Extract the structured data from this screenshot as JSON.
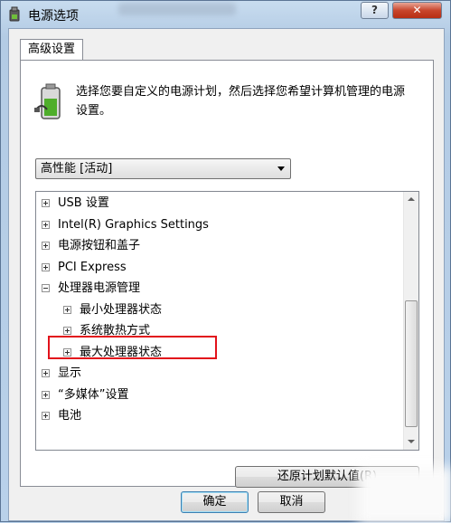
{
  "window": {
    "title": "电源选项",
    "help_label": "?",
    "close_label": "✕"
  },
  "tab": {
    "label": "高级设置"
  },
  "description": "选择您要自定义的电源计划，然后选择您希望计算机管理的电源设置。",
  "plan_select": {
    "value": "高性能 [活动]"
  },
  "tree": {
    "items": [
      {
        "label": "USB 设置",
        "level": 0,
        "expander": "plus"
      },
      {
        "label": "Intel(R) Graphics Settings",
        "level": 0,
        "expander": "plus"
      },
      {
        "label": "电源按钮和盖子",
        "level": 0,
        "expander": "plus"
      },
      {
        "label": "PCI Express",
        "level": 0,
        "expander": "plus"
      },
      {
        "label": "处理器电源管理",
        "level": 0,
        "expander": "minus"
      },
      {
        "label": "最小处理器状态",
        "level": 1,
        "expander": "plus"
      },
      {
        "label": "系统散热方式",
        "level": 1,
        "expander": "plus",
        "highlighted": true
      },
      {
        "label": "最大处理器状态",
        "level": 1,
        "expander": "plus"
      },
      {
        "label": "显示",
        "level": 0,
        "expander": "plus"
      },
      {
        "label": "“多媒体”设置",
        "level": 0,
        "expander": "plus"
      },
      {
        "label": "电池",
        "level": 0,
        "expander": "plus"
      }
    ]
  },
  "buttons": {
    "restore_label": "还原计划默认值(R)",
    "ok_label": "确定",
    "cancel_label": "取消"
  },
  "colors": {
    "highlight_border": "#e2121b",
    "titlebar": "#b9d1ea",
    "close_button": "#c8452c"
  }
}
